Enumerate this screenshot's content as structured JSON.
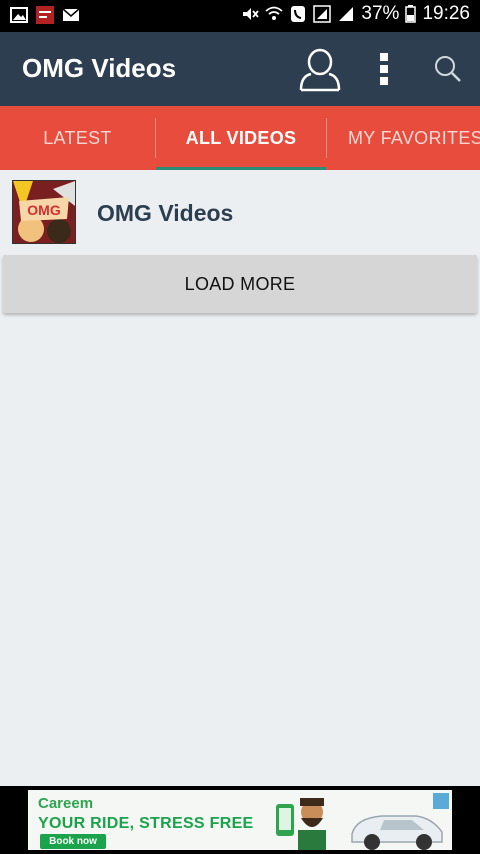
{
  "status_bar": {
    "battery": "37%",
    "time": "19:26"
  },
  "app_bar": {
    "title": "OMG Videos"
  },
  "tabs": [
    {
      "label": "LATEST",
      "active": false
    },
    {
      "label": "ALL VIDEOS",
      "active": true
    },
    {
      "label": "MY FAVORITES",
      "active": false
    }
  ],
  "list": {
    "items": [
      {
        "title": "OMG Videos",
        "thumb_text": "OMG"
      }
    ]
  },
  "load_more_label": "LOAD MORE",
  "ad": {
    "brand": "Careem",
    "headline": "YOUR RIDE, STRESS FREE",
    "cta": "Book now"
  },
  "colors": {
    "app_bar": "#2c3e50",
    "tab_bar": "#e74c3c",
    "tab_indicator": "#2c8c7a",
    "background": "#eceff1",
    "ad_green": "#1aa34a"
  }
}
